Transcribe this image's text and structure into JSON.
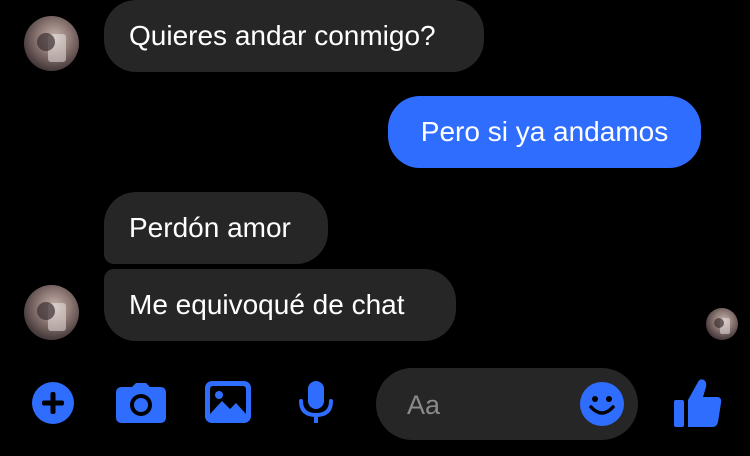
{
  "messages": [
    {
      "sender": "other",
      "text": "Quieres andar conmigo?"
    },
    {
      "sender": "me",
      "text": "Pero si ya andamos"
    },
    {
      "sender": "other",
      "text": "Perdón amor"
    },
    {
      "sender": "other",
      "text": "Me equivoqué de chat"
    }
  ],
  "composer": {
    "placeholder": "Aa"
  },
  "icons": {
    "add": "plus-circle-icon",
    "camera": "camera-icon",
    "gallery": "image-icon",
    "voice": "microphone-icon",
    "emoji": "smiley-icon",
    "like": "thumbs-up-icon"
  },
  "colors": {
    "background": "#000000",
    "incoming_bubble": "#262626",
    "outgoing_bubble": "#2f6dff",
    "accent": "#2f6dff",
    "placeholder": "#8a8a8a"
  }
}
